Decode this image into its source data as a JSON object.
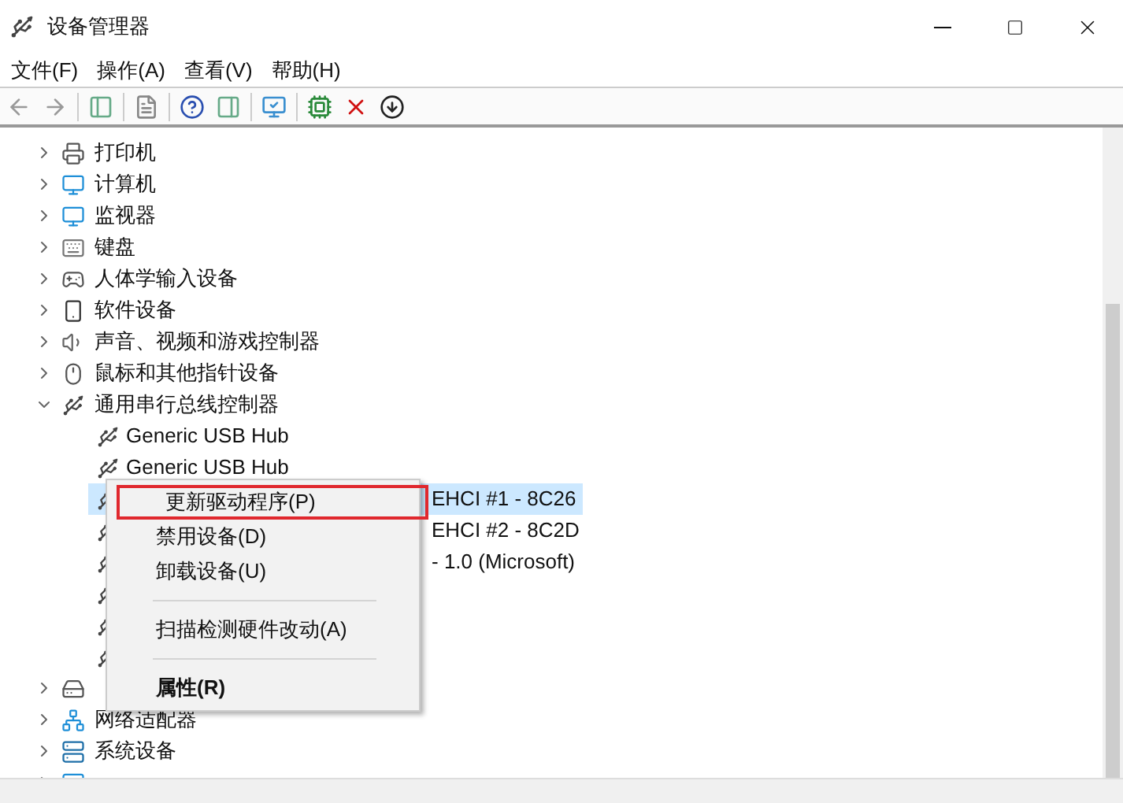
{
  "window": {
    "title": "设备管理器"
  },
  "menu": [
    "文件(F)",
    "操作(A)",
    "查看(V)",
    "帮助(H)"
  ],
  "tree": [
    {
      "kind": "printer",
      "label": "打印机",
      "expanded": false
    },
    {
      "kind": "computer",
      "label": "计算机",
      "expanded": false
    },
    {
      "kind": "monitor",
      "label": "监视器",
      "expanded": false
    },
    {
      "kind": "keyboard",
      "label": "键盘",
      "expanded": false
    },
    {
      "kind": "hid",
      "label": "人体学输入设备",
      "expanded": false
    },
    {
      "kind": "software",
      "label": "软件设备",
      "expanded": false
    },
    {
      "kind": "sound",
      "label": "声音、视频和游戏控制器",
      "expanded": false
    },
    {
      "kind": "mouse",
      "label": "鼠标和其他指针设备",
      "expanded": false
    },
    {
      "kind": "usb",
      "label": "通用串行总线控制器",
      "expanded": true,
      "children": [
        {
          "kind": "usb",
          "label": "Generic USB Hub",
          "selected": false
        },
        {
          "kind": "usb",
          "label": "Generic USB Hub",
          "selected": false
        },
        {
          "kind": "usb",
          "label": "EHCI #1 - 8C26",
          "selected": true
        },
        {
          "kind": "usb",
          "label": "EHCI #2 - 8C2D",
          "selected": false
        },
        {
          "kind": "usb",
          "label": "- 1.0 (Microsoft)",
          "selected": false
        },
        {
          "kind": "usb",
          "selected": false
        },
        {
          "kind": "usb",
          "selected": false
        },
        {
          "kind": "usb",
          "selected": false
        }
      ]
    },
    {
      "kind": "storage",
      "expanded": false
    },
    {
      "kind": "network",
      "label": "网络适配器",
      "expanded": false
    },
    {
      "kind": "system",
      "label": "系统设备",
      "expanded": false
    },
    {
      "kind": "display",
      "expanded": false
    }
  ],
  "context_menu": {
    "items": [
      {
        "kind": "item",
        "label": "更新驱动程序(P)",
        "selected": true
      },
      {
        "kind": "item",
        "label": "禁用设备(D)",
        "selected": false
      },
      {
        "kind": "item",
        "label": "卸载设备(U)",
        "selected": false
      },
      {
        "kind": "separator"
      },
      {
        "kind": "item",
        "label": "扫描检测硬件改动(A)",
        "selected": false
      },
      {
        "kind": "separator"
      },
      {
        "kind": "bold",
        "label": "属性(R)",
        "selected": false
      }
    ]
  }
}
